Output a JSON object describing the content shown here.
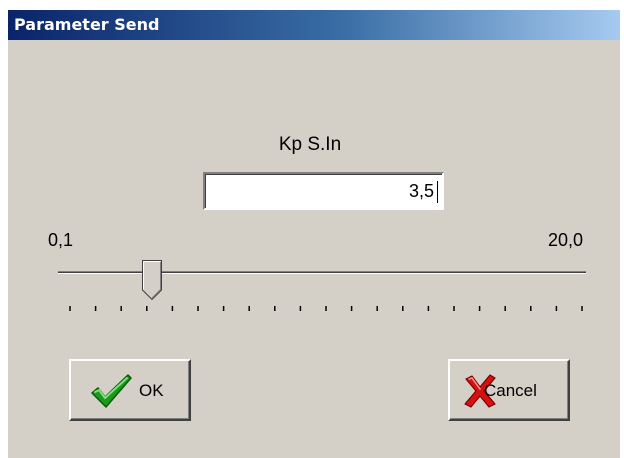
{
  "window": {
    "title": "Parameter Send"
  },
  "parameter": {
    "label": "Kp S.In",
    "value": "3,5"
  },
  "slider": {
    "min_label": "0,1",
    "max_label": "20,0",
    "min": 0.1,
    "max": 20.0,
    "value": 3.5,
    "tick_count": 21
  },
  "buttons": {
    "ok_label": "OK",
    "cancel_label": "Cancel"
  },
  "icons": {
    "ok": "checkmark-icon",
    "cancel": "x-mark-icon"
  },
  "colors": {
    "title_bar_start": "#0a246a",
    "title_bar_end": "#a6caf0",
    "dialog_face": "#d4d0c8",
    "check_green": "#19a019",
    "cross_red": "#d81010"
  }
}
